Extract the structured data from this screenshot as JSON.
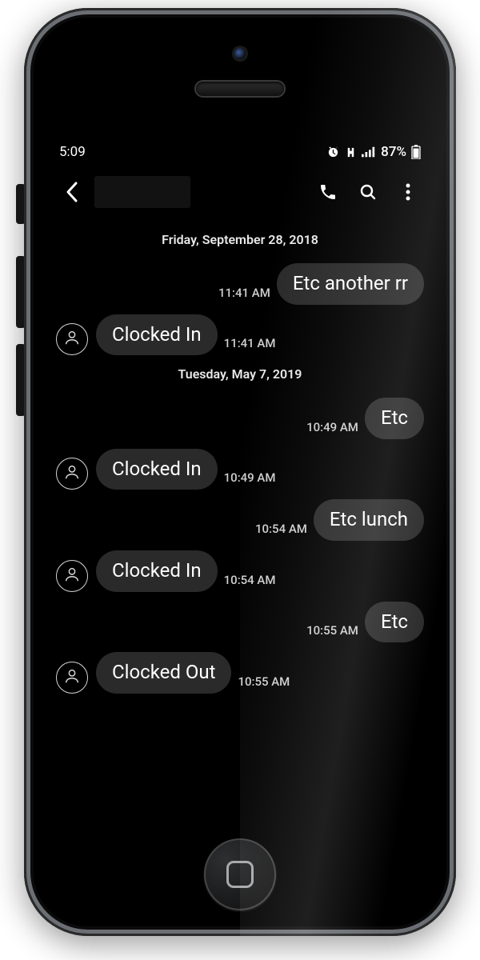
{
  "status": {
    "time": "5:09",
    "battery_pct": "87%"
  },
  "header": {
    "contact_name_redacted": true
  },
  "conversation": [
    {
      "type": "date",
      "label": "Friday, September 28, 2018"
    },
    {
      "type": "msg",
      "dir": "out",
      "text": "Etc another rr",
      "time": "11:41 AM"
    },
    {
      "type": "msg",
      "dir": "in",
      "text": "Clocked In",
      "time": "11:41 AM"
    },
    {
      "type": "date",
      "label": "Tuesday, May 7, 2019"
    },
    {
      "type": "msg",
      "dir": "out",
      "text": "Etc",
      "time": "10:49 AM"
    },
    {
      "type": "msg",
      "dir": "in",
      "text": "Clocked In",
      "time": "10:49 AM"
    },
    {
      "type": "msg",
      "dir": "out",
      "text": "Etc lunch",
      "time": "10:54 AM"
    },
    {
      "type": "msg",
      "dir": "in",
      "text": "Clocked In",
      "time": "10:54 AM"
    },
    {
      "type": "msg",
      "dir": "out",
      "text": "Etc",
      "time": "10:55 AM"
    },
    {
      "type": "msg",
      "dir": "in",
      "text": "Clocked Out",
      "time": "10:55 AM"
    }
  ]
}
